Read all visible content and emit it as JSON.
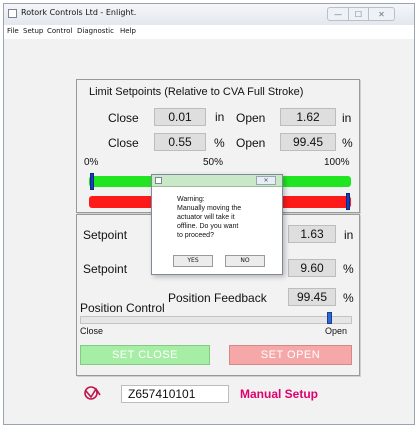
{
  "window": {
    "title": "Rotork Controls Ltd - Enlight.",
    "minimize_glyph": "—",
    "maximize_glyph": "☐",
    "close_glyph": "✕"
  },
  "menu": [
    "File",
    "Setup",
    "Control",
    "Diagnostic",
    "Help"
  ],
  "limits": {
    "heading": "Limit Setpoints (Relative to CVA Full Stroke)",
    "row_in": {
      "close_label": "Close",
      "close_value": "0.01",
      "close_unit": "in",
      "open_label": "Open",
      "open_value": "1.62",
      "open_unit": "in"
    },
    "row_pct": {
      "close_label": "Close",
      "close_value": "0.55",
      "close_unit": "%",
      "open_label": "Open",
      "open_value": "99.45",
      "open_unit": "%"
    },
    "scale": {
      "min": "0%",
      "mid": "50%",
      "max": "100%"
    },
    "green_marker_percent": 0.55,
    "red_marker_percent": 99.45
  },
  "setpoint": {
    "label_in": "Setpoint",
    "value_in": "1.63",
    "unit_in": "in",
    "label_pct": "Setpoint",
    "value_pct": "9.60",
    "unit_pct": "%",
    "feedback_label": "Position Feedback",
    "feedback_value": "99.45",
    "feedback_unit": "%"
  },
  "position_control": {
    "heading": "Position Control",
    "close_label": "Close",
    "open_label": "Open",
    "slider_percent": 92
  },
  "buttons": {
    "set_close": "SET CLOSE",
    "set_open": "SET OPEN"
  },
  "footer": {
    "serial": "Z657410101",
    "mode": "Manual Setup"
  },
  "dialog": {
    "message": "Warning:\nManually moving the\nactuator will take it\noffline. Do you want\nto proceed?",
    "yes": "YES",
    "no": "NO",
    "close_glyph": "✕"
  },
  "colors": {
    "green_bar": "#22e522",
    "red_bar": "#ff1a1a",
    "marker": "#1040c0",
    "mode_text": "#e0006e",
    "set_close_bg": "#a6eea6",
    "set_open_bg": "#f6a8a8"
  },
  "icons": {
    "logo": "rotork-logo-icon",
    "app": "app-icon"
  }
}
